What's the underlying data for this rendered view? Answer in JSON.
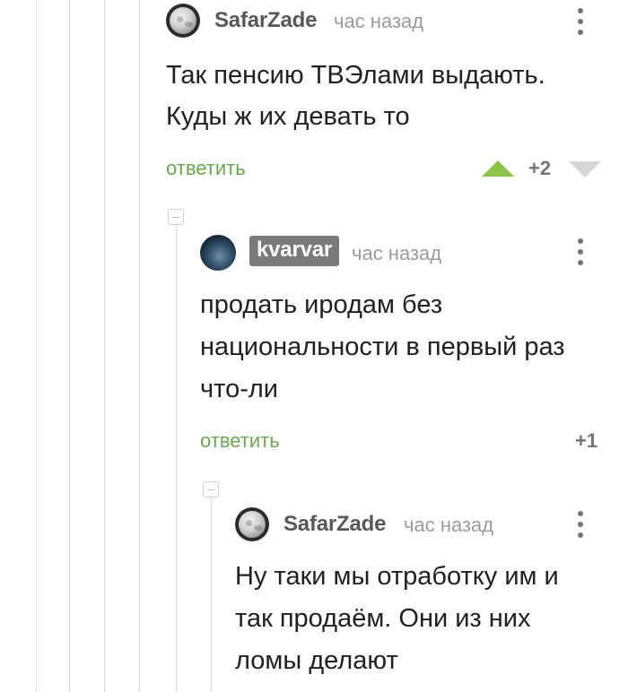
{
  "comments": [
    {
      "author": "SafarZade",
      "time": "час назад",
      "lines": [
        "Так пенсию ТВЭлами выдають.",
        "Куды ж их девать то"
      ],
      "reply_label": "ответить",
      "rating": "+2"
    },
    {
      "author": "kvarvar",
      "time": "час назад",
      "lines": [
        "продать иродам без",
        "национальности в первый раз",
        "что-ли"
      ],
      "reply_label": "ответить",
      "rating": "+1"
    },
    {
      "author": "SafarZade",
      "time": "час назад",
      "lines": [
        "Ну таки мы отработку им и",
        "так продаём. Они из них",
        "ломы делают"
      ]
    }
  ],
  "colors": {
    "reply": "#6aa84f",
    "upvote_active": "#8bc34a",
    "downvote": "#d6d6d6",
    "author_badge": "#7a7a7a"
  },
  "icons": {
    "upvote": "triangle-up-icon",
    "downvote": "triangle-down-icon",
    "more": "more-vertical-icon",
    "collapse": "collapse-minus-icon"
  }
}
